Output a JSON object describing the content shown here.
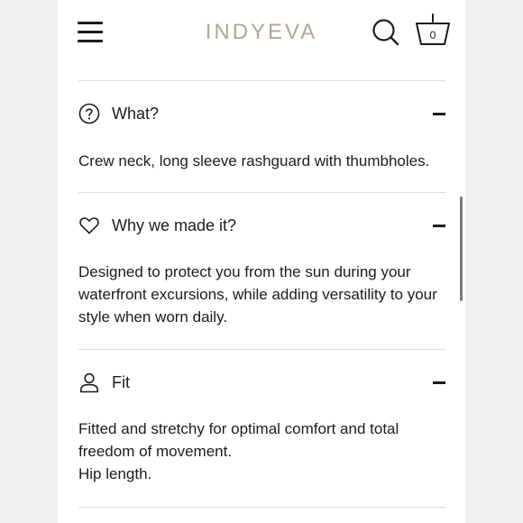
{
  "header": {
    "logo_text": "INDYEVA",
    "cart_count": "0"
  },
  "sections": [
    {
      "icon": "question-circle-icon",
      "title": "What?",
      "body": [
        "Crew neck, long sleeve rashguard with thumbholes."
      ]
    },
    {
      "icon": "heart-icon",
      "title": "Why we made it?",
      "body": [
        "Designed to protect you from the sun during your waterfront excursions, while adding versatility to your style when worn daily."
      ]
    },
    {
      "icon": "person-icon",
      "title": "Fit",
      "body": [
        "Fitted and stretchy for optimal comfort and total freedom of movement.",
        "Hip length."
      ]
    }
  ],
  "colors": {
    "logo": "#b8a397",
    "background": "#f1efee",
    "text": "#1c1c1c",
    "divider": "#dcdcdc"
  }
}
